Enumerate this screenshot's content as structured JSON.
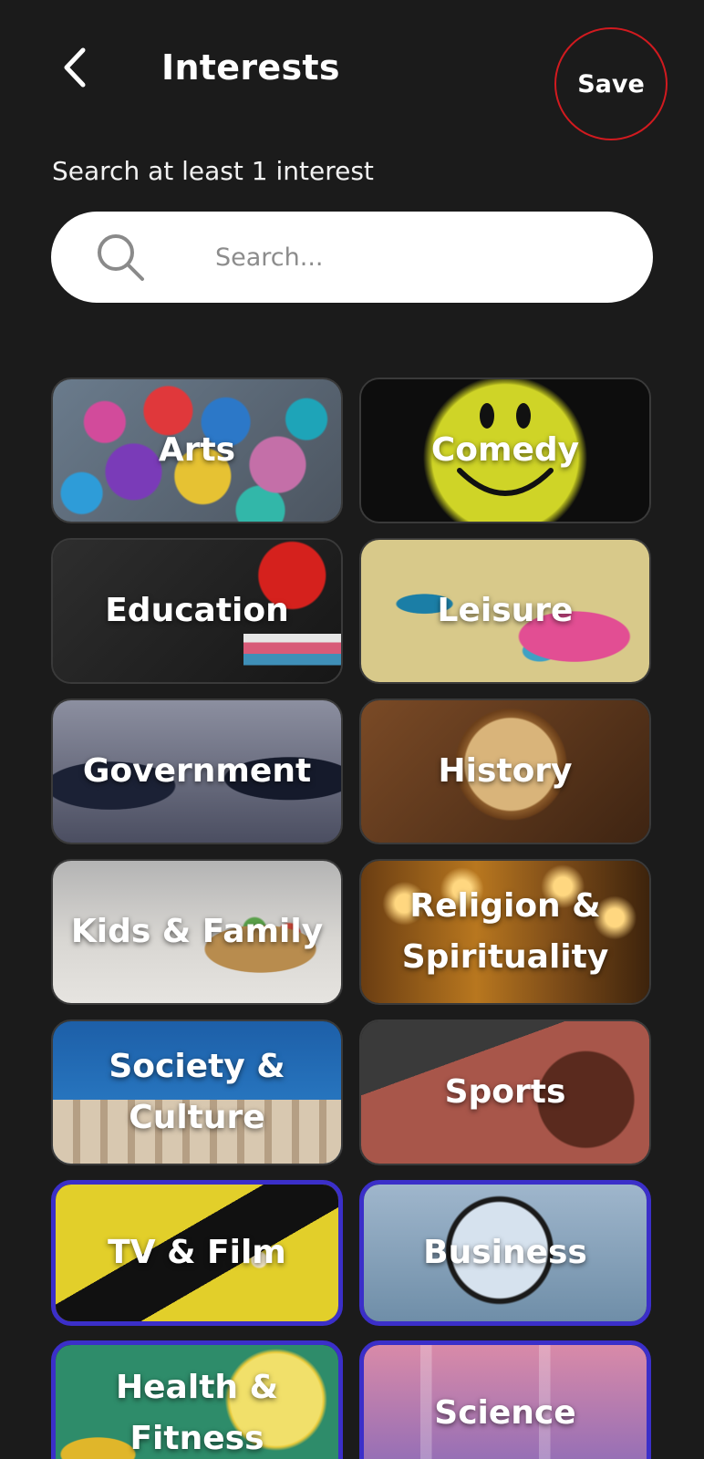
{
  "header": {
    "title": "Interests",
    "save_label": "Save"
  },
  "subtitle": "Search at least 1 interest",
  "search": {
    "placeholder": "Search...",
    "value": ""
  },
  "colors": {
    "background": "#1b1b1b",
    "save_highlight_circle": "#d11a1f",
    "selected_border": "#3b2fc9"
  },
  "interests": [
    {
      "label": "Arts",
      "selected": false
    },
    {
      "label": "Comedy",
      "selected": false
    },
    {
      "label": "Education",
      "selected": false
    },
    {
      "label": "Leisure",
      "selected": false
    },
    {
      "label": "Government",
      "selected": false
    },
    {
      "label": "History",
      "selected": false
    },
    {
      "label": "Kids & Family",
      "selected": false
    },
    {
      "label": "Religion & Spirituality",
      "selected": false
    },
    {
      "label": "Society & Culture",
      "selected": false
    },
    {
      "label": "Sports",
      "selected": false
    },
    {
      "label": "TV & Film",
      "selected": true
    },
    {
      "label": "Business",
      "selected": true
    },
    {
      "label": "Health & Fitness",
      "selected": true
    },
    {
      "label": "Science",
      "selected": true
    }
  ]
}
